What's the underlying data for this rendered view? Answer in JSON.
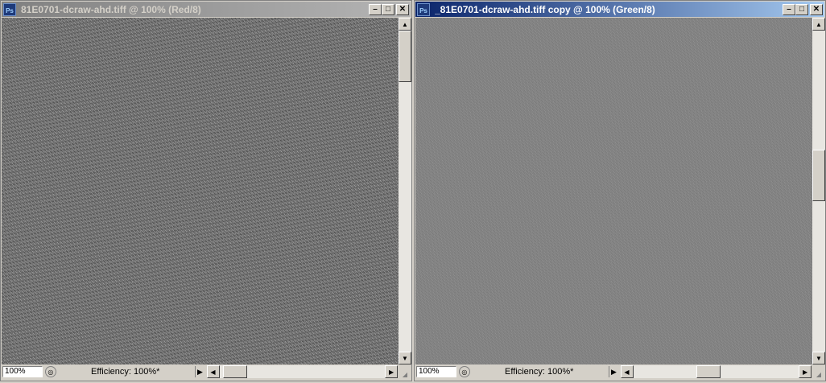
{
  "windows": [
    {
      "title": "81E0701-dcraw-ahd.tiff @ 100% (Red/8)",
      "state": "inactive",
      "zoom": "100%",
      "efficiency": "Efficiency: 100%*"
    },
    {
      "title": "_81E0701-dcraw-ahd.tiff copy @ 100% (Green/8)",
      "state": "active",
      "zoom": "100%",
      "efficiency": "Efficiency: 100%*"
    }
  ],
  "icons": {
    "app": "photoshop-icon",
    "app_text": "Ps",
    "minimize": "minimize-icon",
    "maximize": "maximize-icon",
    "close": "close-icon",
    "navigator": "navigator-icon",
    "arrow_up": "arrow-up-icon",
    "arrow_down": "arrow-down-icon",
    "arrow_left": "arrow-left-icon",
    "arrow_right": "arrow-right-icon",
    "status_menu": "triangle-right-icon"
  },
  "colors": {
    "active_title": "#0a246a",
    "inactive_title": "#808080",
    "chrome": "#d4d0c8"
  }
}
